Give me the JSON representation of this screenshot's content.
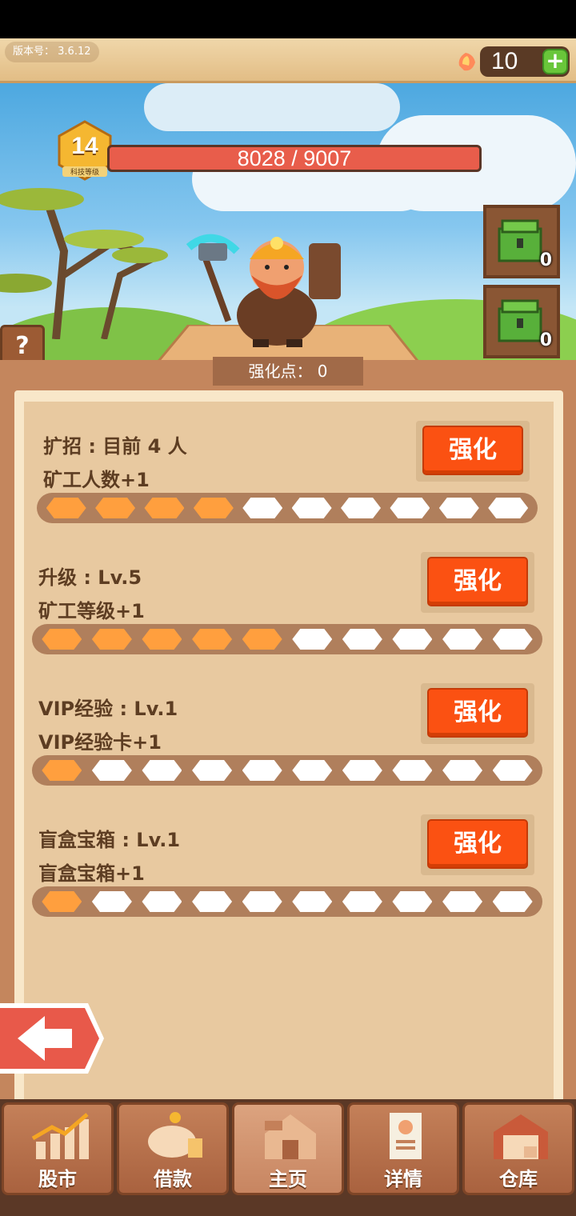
{
  "version": {
    "label": "版本号：",
    "value": "3.6.12"
  },
  "currency": {
    "value": "10",
    "plus": "+"
  },
  "tech_level": {
    "value": "14",
    "caption": "科技等级"
  },
  "progress": {
    "text": "8028 / 9007",
    "current": 8028,
    "max": 9007
  },
  "chests": [
    {
      "count": "0"
    },
    {
      "count": "0"
    }
  ],
  "help": {
    "label": "?"
  },
  "points": {
    "text": "强化点： 0"
  },
  "upgrades": [
    {
      "line1": "扩招 : 目前 4 人",
      "line2": "矿工人数+1",
      "button": "强化",
      "filled": 4,
      "total": 10
    },
    {
      "line1": "升级 : Lv.5",
      "line2": "矿工等级+1",
      "button": "强化",
      "filled": 5,
      "total": 10
    },
    {
      "line1": "VIP经验 : Lv.1",
      "line2": "VIP经验卡+1",
      "button": "强化",
      "filled": 1,
      "total": 10
    },
    {
      "line1": "盲盒宝箱 : Lv.1",
      "line2": "盲盒宝箱+1",
      "button": "强化",
      "filled": 1,
      "total": 10
    }
  ],
  "nav": [
    {
      "label": "股市",
      "icon": "chart-icon"
    },
    {
      "label": "借款",
      "icon": "piggy-bank-icon"
    },
    {
      "label": "主页",
      "icon": "home-icon"
    },
    {
      "label": "详情",
      "icon": "profile-icon"
    },
    {
      "label": "仓库",
      "icon": "warehouse-icon"
    }
  ],
  "colors": {
    "accent": "#fb5112",
    "filled_segment": "#ff9f3e",
    "hp_bar": "#e85d4b"
  }
}
